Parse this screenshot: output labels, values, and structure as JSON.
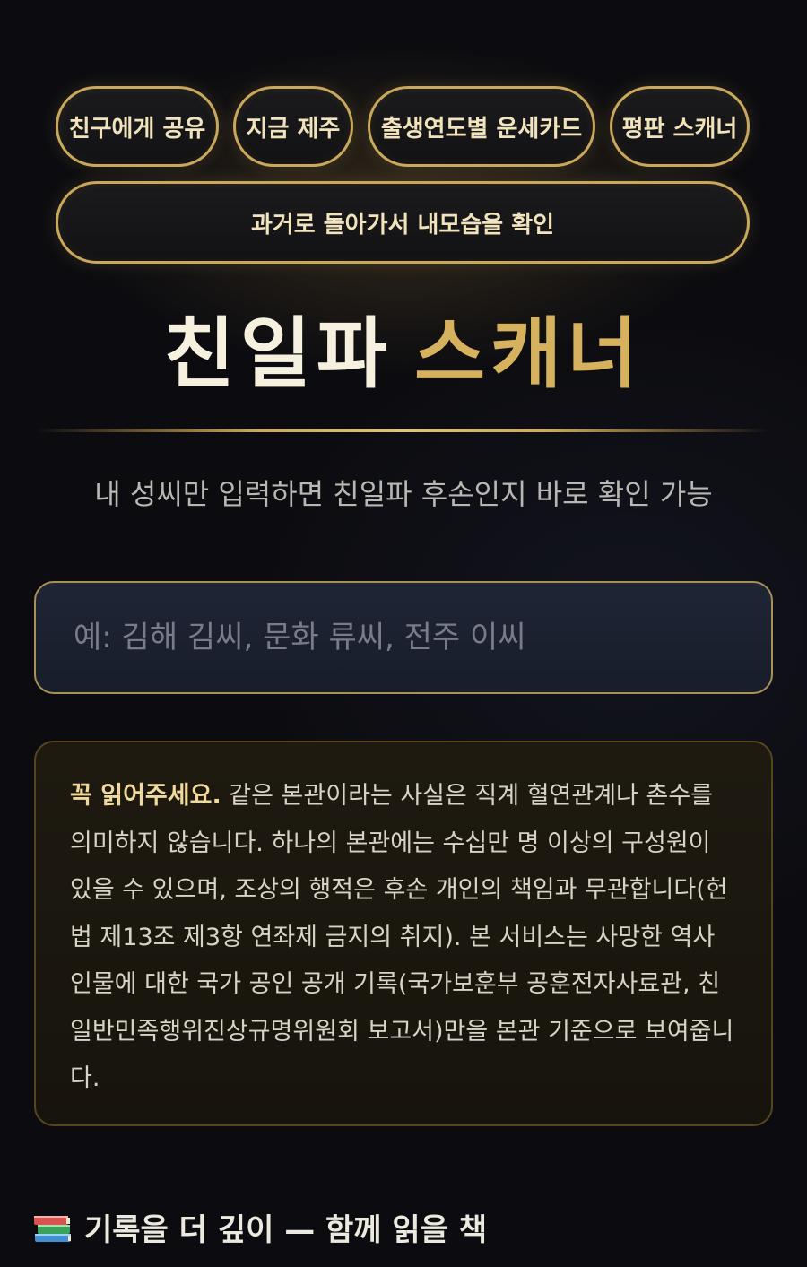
{
  "nav": {
    "share": "친구에게 공유",
    "jeju": "지금 제주",
    "fortune_card": "출생연도별 운세카드",
    "reputation": "평판 스캐너",
    "past_self": "과거로 돌아가서 내모습을 확인"
  },
  "header": {
    "title_part1": "친일파",
    "title_part2": "스캐너",
    "subtitle": "내 성씨만 입력하면 친일파 후손인지 바로 확인 가능"
  },
  "search": {
    "placeholder": "예: 김해 김씨, 문화 류씨, 전주 이씨",
    "value": ""
  },
  "notice": {
    "lead": "꼭 읽어주세요.",
    "body": " 같은 본관이라는 사실은 직계 혈연관계나 촌수를 의미하지 않습니다. 하나의 본관에는 수십만 명 이상의 구성원이 있을 수 있으며, 조상의 행적은 후손 개인의 책임과 무관합니다(헌법 제13조 제3항 연좌제 금지의 취지). 본 서비스는 사망한 역사 인물에 대한 국가 공인 공개 기록(국가보훈부 공훈전자사료관, 친일반민족행위진상규명위원회 보고서)만을 본관 기준으로 보여줍니다."
  },
  "books_section": {
    "icon": "books-icon",
    "title": "기록을 더 깊이 — 함께 읽을 책"
  },
  "colors": {
    "gold": "#c9a85b",
    "title_white": "#f6f0df",
    "title_gold": "#d6b25e",
    "background": "#0c0c10"
  }
}
